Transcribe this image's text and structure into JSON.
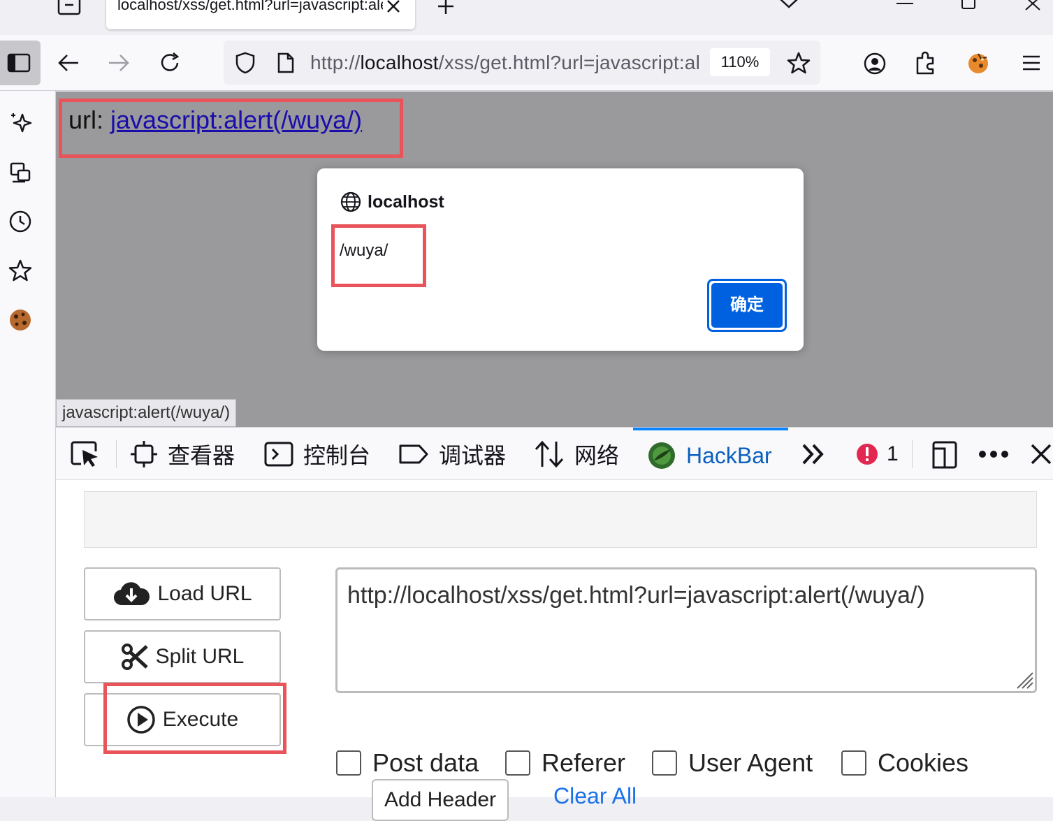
{
  "browser": {
    "tab_title": "localhost/xss/get.html?url=javascript:alert(/wuya/)",
    "url_scheme": "http://",
    "url_host": "localhost",
    "url_path": "/xss/get.html?url=javascript:alert(/wuya/)",
    "zoom": "110%"
  },
  "page": {
    "url_label": "url: ",
    "url_link": "javascript:alert(/wuya/)",
    "status_tooltip": "javascript:alert(/wuya/)"
  },
  "alert": {
    "origin": "localhost",
    "message": "/wuya/",
    "ok_label": "确定"
  },
  "devtools": {
    "tabs": {
      "inspector": "查看器",
      "console": "控制台",
      "debugger": "调试器",
      "network": "网络",
      "hackbar": "HackBar"
    },
    "error_count": "1",
    "accent_color": "#0a84ff"
  },
  "hackbar": {
    "load_url": "Load URL",
    "split_url": "Split URL",
    "execute": "Execute",
    "url_value": "http://localhost/xss/get.html?url=javascript:alert(/wuya/)",
    "options": {
      "post_data": "Post data",
      "referer": "Referer",
      "user_agent": "User Agent",
      "cookies": "Cookies"
    },
    "add_header": "Add Header",
    "clear_all": "Clear All"
  },
  "highlight_color": "#e9545a"
}
